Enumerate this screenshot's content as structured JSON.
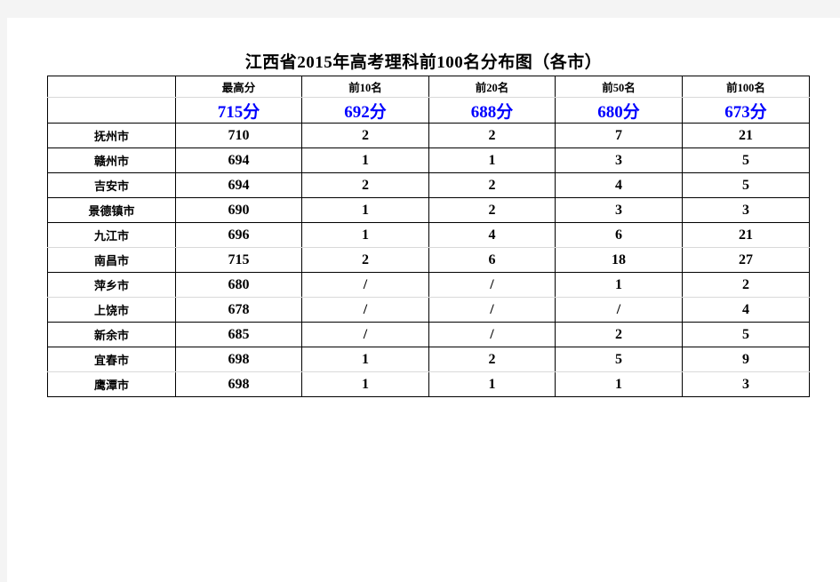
{
  "document": {
    "title": "江西省2015年高考理科前100名分布图（各市）"
  },
  "table": {
    "column_headers": [
      "",
      "最高分",
      "前10名",
      "前20名",
      "前50名",
      "前100名"
    ],
    "cutoff_row_label": "",
    "cutoff_scores": [
      "715分",
      "692分",
      "688分",
      "680分",
      "673分"
    ],
    "rows": [
      {
        "city": "抚州市",
        "highest": "710",
        "top10": "2",
        "top20": "2",
        "top50": "7",
        "top100": "21"
      },
      {
        "city": "赣州市",
        "highest": "694",
        "top10": "1",
        "top20": "1",
        "top50": "3",
        "top100": "5"
      },
      {
        "city": "吉安市",
        "highest": "694",
        "top10": "2",
        "top20": "2",
        "top50": "4",
        "top100": "5"
      },
      {
        "city": "景德镇市",
        "highest": "690",
        "top10": "1",
        "top20": "2",
        "top50": "3",
        "top100": "3"
      },
      {
        "city": "九江市",
        "highest": "696",
        "top10": "1",
        "top20": "4",
        "top50": "6",
        "top100": "21"
      },
      {
        "city": "南昌市",
        "highest": "715",
        "top10": "2",
        "top20": "6",
        "top50": "18",
        "top100": "27"
      },
      {
        "city": "萍乡市",
        "highest": "680",
        "top10": "/",
        "top20": "/",
        "top50": "1",
        "top100": "2"
      },
      {
        "city": "上饶市",
        "highest": "678",
        "top10": "/",
        "top20": "/",
        "top50": "/",
        "top100": "4"
      },
      {
        "city": "新余市",
        "highest": "685",
        "top10": "/",
        "top20": "/",
        "top50": "2",
        "top100": "5"
      },
      {
        "city": "宜春市",
        "highest": "698",
        "top10": "1",
        "top20": "2",
        "top50": "5",
        "top100": "9"
      },
      {
        "city": "鹰潭市",
        "highest": "698",
        "top10": "1",
        "top20": "1",
        "top50": "1",
        "top100": "3"
      }
    ]
  },
  "colors": {
    "blue": "#0000ff",
    "red": "#ff0000",
    "text": "#000000",
    "page_bg": "#ffffff",
    "canvas_bg": "#f4f4f4",
    "grid": "#000000",
    "grid_soft": "#d9d9d9"
  },
  "chart_data": {
    "type": "table",
    "title": "江西省2015年高考理科前100名分布图（各市）",
    "categories": [
      "抚州市",
      "赣州市",
      "吉安市",
      "景德镇市",
      "九江市",
      "南昌市",
      "萍乡市",
      "上饶市",
      "新余市",
      "宜春市",
      "鹰潭市"
    ],
    "columns": [
      "最高分",
      "前10名",
      "前20名",
      "前50名",
      "前100名"
    ],
    "cutoffs": [
      715,
      692,
      688,
      680,
      673
    ],
    "series": [
      {
        "name": "最高分",
        "values": [
          710,
          694,
          694,
          690,
          696,
          715,
          680,
          678,
          685,
          698,
          698
        ]
      },
      {
        "name": "前10名",
        "values": [
          2,
          1,
          2,
          1,
          1,
          2,
          null,
          null,
          null,
          1,
          1
        ]
      },
      {
        "name": "前20名",
        "values": [
          2,
          1,
          2,
          2,
          4,
          6,
          null,
          null,
          null,
          2,
          1
        ]
      },
      {
        "name": "前50名",
        "values": [
          7,
          3,
          4,
          3,
          6,
          18,
          1,
          null,
          2,
          5,
          1
        ]
      },
      {
        "name": "前100名",
        "values": [
          21,
          5,
          5,
          3,
          21,
          27,
          2,
          4,
          5,
          9,
          3
        ]
      }
    ],
    "null_marker": "/"
  }
}
